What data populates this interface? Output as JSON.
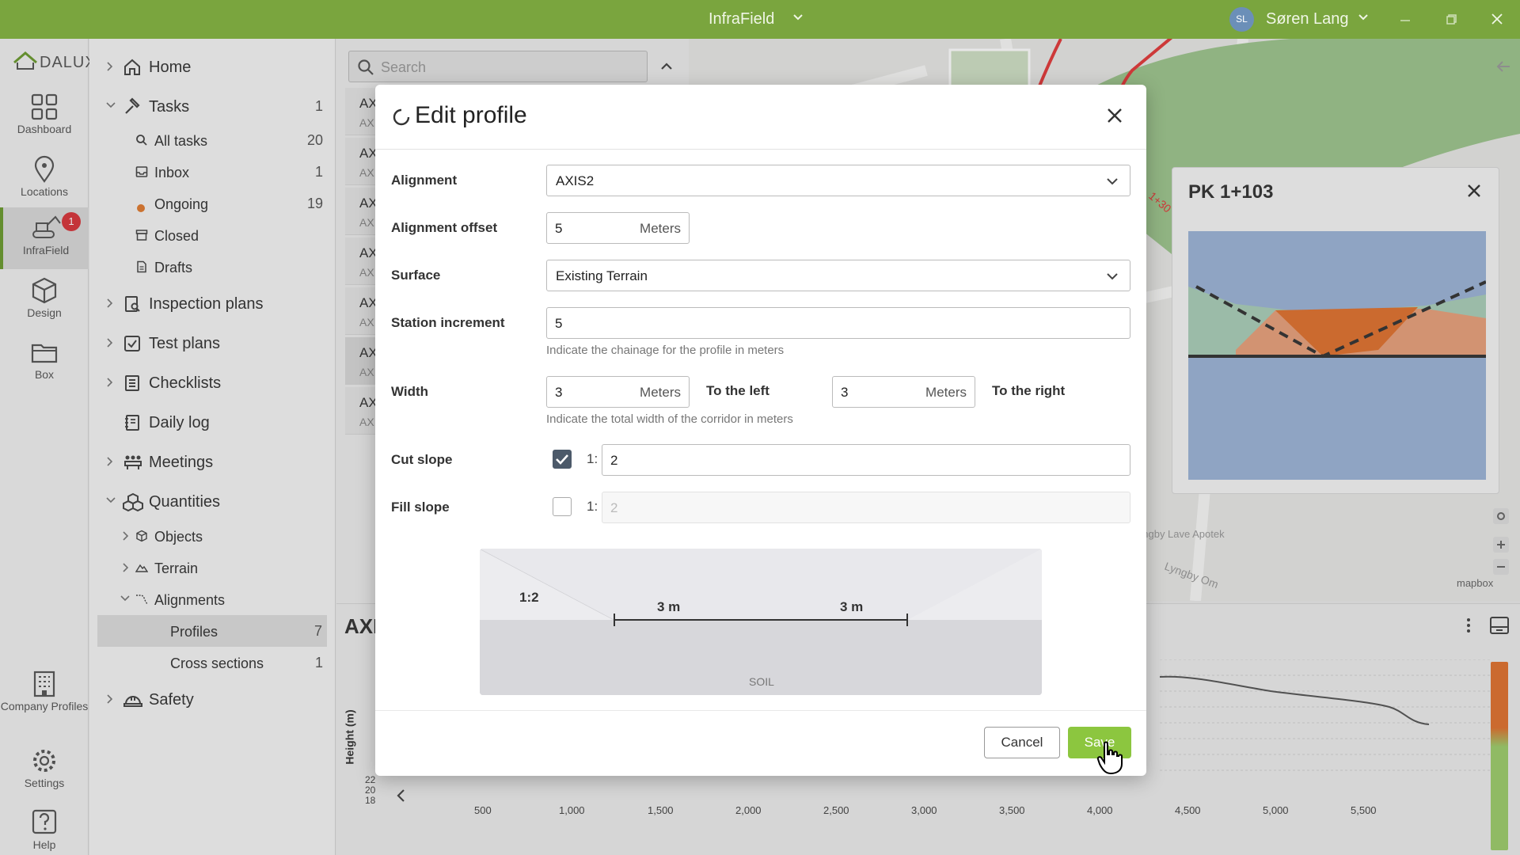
{
  "titlebar": {
    "app_name": "InfraField",
    "user_initials": "SL",
    "user_name": "Søren Lang"
  },
  "rail": {
    "logo": "DALUX",
    "items": [
      {
        "label": "Dashboard"
      },
      {
        "label": "Locations"
      },
      {
        "label": "InfraField",
        "badge": "1"
      },
      {
        "label": "Design"
      },
      {
        "label": "Box"
      },
      {
        "label": "Company Profiles"
      },
      {
        "label": "Settings"
      },
      {
        "label": "Help"
      }
    ]
  },
  "nav": {
    "home": "Home",
    "tasks": {
      "label": "Tasks",
      "count": "1"
    },
    "all_tasks": {
      "label": "All tasks",
      "count": "20"
    },
    "inbox": {
      "label": "Inbox",
      "count": "1"
    },
    "ongoing": {
      "label": "Ongoing",
      "count": "19"
    },
    "closed": "Closed",
    "drafts": "Drafts",
    "inspection_plans": "Inspection plans",
    "test_plans": "Test plans",
    "checklists": "Checklists",
    "daily_log": "Daily log",
    "meetings": "Meetings",
    "quantities": "Quantities",
    "objects": "Objects",
    "terrain": "Terrain",
    "alignments": "Alignments",
    "profiles": {
      "label": "Profiles",
      "count": "7"
    },
    "cross_sections": {
      "label": "Cross sections",
      "count": "1"
    },
    "safety": "Safety"
  },
  "list": {
    "search_placeholder": "Search",
    "rows": [
      {
        "t": "AX",
        "s": "AX"
      },
      {
        "t": "AX",
        "s": "AX"
      },
      {
        "t": "AX",
        "s": "AX"
      },
      {
        "t": "AX",
        "s": "AX"
      },
      {
        "t": "AX",
        "s": "AX"
      },
      {
        "t": "AX",
        "s": "AX"
      },
      {
        "t": "AX",
        "s": "AX"
      }
    ]
  },
  "map": {
    "label_lave": "Lyngby Lave Apotek",
    "label_road": "Lyngby Om",
    "label_station": "1+30",
    "brand": "mapbox"
  },
  "pk_panel": {
    "title": "PK 1+103"
  },
  "chart": {
    "title": "AXI",
    "ylabel": "Height (m)",
    "x_ticks": [
      "500",
      "1,000",
      "1,500",
      "2,000",
      "2,500",
      "3,000",
      "3,500",
      "4,000",
      "4,500",
      "5,000",
      "5,500"
    ],
    "y_ticks_partial": [
      "22",
      "20",
      "18"
    ]
  },
  "modal": {
    "title": "Edit profile",
    "alignment_label": "Alignment",
    "alignment_value": "AXIS2",
    "offset_label": "Alignment offset",
    "offset_value": "5",
    "offset_unit": "Meters",
    "surface_label": "Surface",
    "surface_value": "Existing Terrain",
    "station_label": "Station increment",
    "station_value": "5",
    "station_hint": "Indicate the chainage for the profile in meters",
    "width_label": "Width",
    "width_left_value": "3",
    "width_left_unit": "Meters",
    "width_left_label": "To the left",
    "width_right_value": "3",
    "width_right_unit": "Meters",
    "width_right_label": "To the right",
    "width_hint": "Indicate the total width of the corridor in meters",
    "cut_label": "Cut slope",
    "cut_checked": true,
    "cut_prefix": "1:",
    "cut_value": "2",
    "fill_label": "Fill slope",
    "fill_checked": false,
    "fill_prefix": "1:",
    "fill_value": "2",
    "preview": {
      "slope": "1:2",
      "left_width": "3 m",
      "right_width": "3 m",
      "soil": "SOIL"
    },
    "cancel_label": "Cancel",
    "save_label": "Save"
  },
  "colors": {
    "brand_green": "#7aa53e",
    "save_green": "#8cc63f",
    "badge_red": "#d8343a"
  }
}
